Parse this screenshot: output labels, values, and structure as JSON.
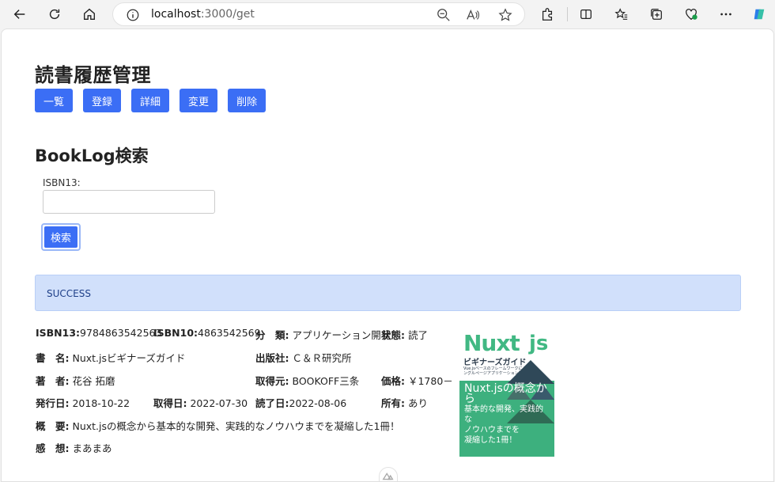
{
  "browser": {
    "url_host": "localhost",
    "url_rest": ":3000/get"
  },
  "page": {
    "title": "読書履歴管理",
    "nav": [
      "一覧",
      "登録",
      "詳細",
      "変更",
      "削除"
    ],
    "search_heading": "BookLog検索",
    "isbn_label": "ISBN13:",
    "isbn_value": "",
    "search_button": "検索",
    "alert": "SUCCESS"
  },
  "book": {
    "isbn13_label": "ISBN13:",
    "isbn13": "9784863542563",
    "isbn10_label": "ISBN10:",
    "isbn10": "4863542569",
    "category_label": "分　類:",
    "category": "アプリケーション開発",
    "status_label": "状態:",
    "status": "読了",
    "title_label": "書　名:",
    "title": "Nuxt.jsビギナーズガイド",
    "publisher_label": "出版社:",
    "publisher": "Ｃ＆Ｒ研究所",
    "author_label": "著　者:",
    "author": "花谷 拓磨",
    "source_label": "取得元:",
    "source": "BOOKOFF三条",
    "price_label": "価格:",
    "price": "￥1780－",
    "published_label": "発行日:",
    "published": "2018-10-22",
    "acquired_label": "取得日:",
    "acquired": "2022-07-30",
    "read_label": "読了日:",
    "read": "2022-08-06",
    "owned_label": "所有:",
    "owned": "あり",
    "summary_label": "概　要:",
    "summary": "Nuxt.jsの概念から基本的な開発、実践的なノウハウまでを凝縮した1冊！",
    "impression_label": "感　想:",
    "impression": "まあまあ"
  },
  "cover": {
    "title": "Nuxt",
    "title_js": "js",
    "subtitle": "ビギナーズガイド",
    "tagline": "Vue.jsベースのフレームワークによるシングルページアプリケーション開発",
    "line1": "Nuxt.jsの概念から",
    "line2": "基本的な開発、実践的な",
    "line3": "ノウハウまでを",
    "line4": "凝縮した1冊！"
  },
  "colors": {
    "primary": "#3b6ef5",
    "alert_bg": "#d1e0fb",
    "nuxt_green": "#41b883"
  }
}
